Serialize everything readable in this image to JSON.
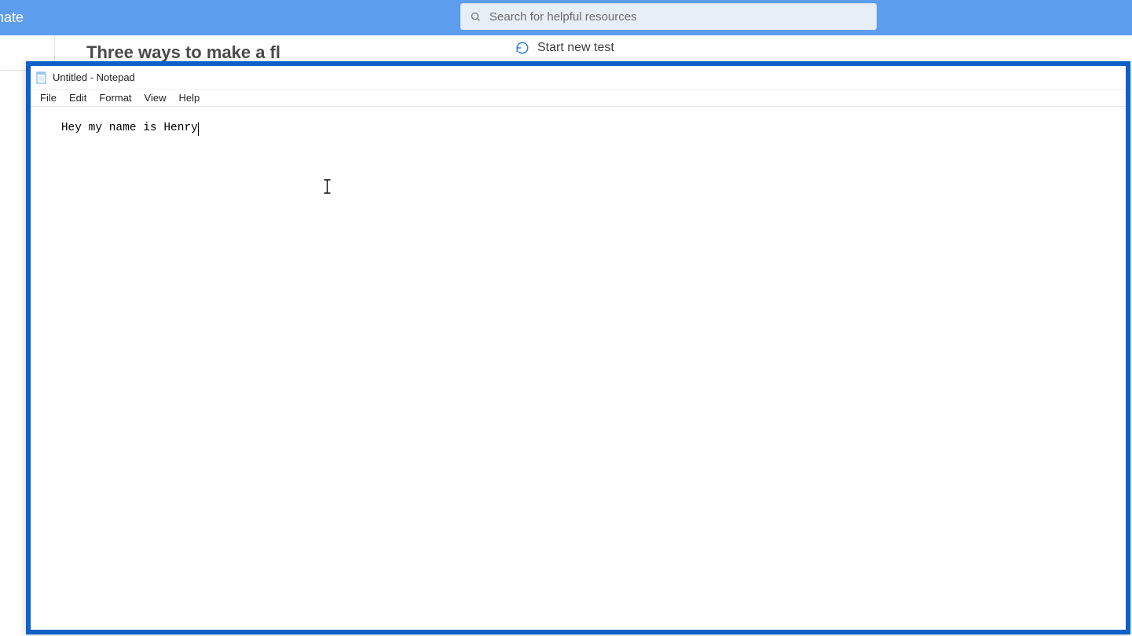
{
  "background": {
    "header_title_fragment": "mate",
    "search_placeholder": "Search for helpful resources",
    "sub_heading": "Three ways to make a fl",
    "start_new_test": "Start new test"
  },
  "notepad": {
    "window_title": "Untitled - Notepad",
    "menu": {
      "file": "File",
      "edit": "Edit",
      "format": "Format",
      "view": "View",
      "help": "Help"
    },
    "content": "Hey my name is Henry"
  }
}
